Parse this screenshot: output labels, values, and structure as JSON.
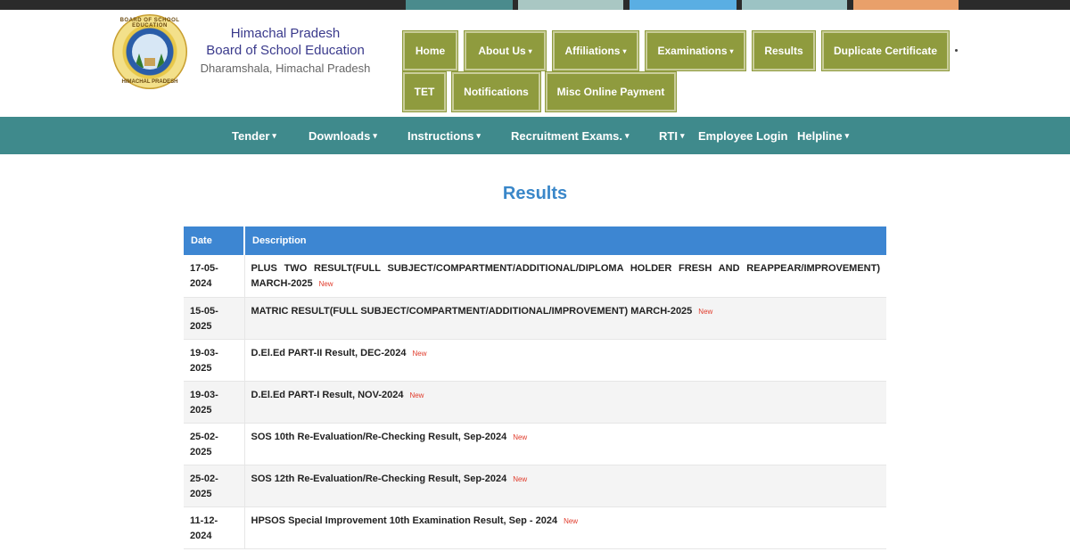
{
  "top_strip": {
    "tabs": [
      {
        "color": "#4a8b8d"
      },
      {
        "color": "#a9c7c3"
      },
      {
        "color": "#5aaee3"
      },
      {
        "color": "#9cc3c4"
      },
      {
        "color": "#e9a06a"
      }
    ]
  },
  "header": {
    "logo": {
      "top_text": "BOARD OF SCHOOL EDUCATION",
      "bottom_text": "HIMACHAL PRADESH"
    },
    "org_line1": "Himachal Pradesh",
    "org_line2": "Board of School Education",
    "org_line3": "Dharamshala, Himachal Pradesh"
  },
  "main_nav": {
    "items": [
      {
        "label": "Home",
        "dropdown": false
      },
      {
        "label": "About Us",
        "dropdown": true
      },
      {
        "label": "Affiliations",
        "dropdown": true
      },
      {
        "label": "Examinations",
        "dropdown": true
      },
      {
        "label": "Results",
        "dropdown": false
      },
      {
        "label": "Duplicate Certificate",
        "dropdown": false
      },
      {
        "label": "TET",
        "dropdown": false
      },
      {
        "label": "Notifications",
        "dropdown": false
      },
      {
        "label": "Misc Online Payment",
        "dropdown": false
      }
    ],
    "caret": "▾"
  },
  "secondary_nav": {
    "items": [
      {
        "label": "Tender",
        "dropdown": true
      },
      {
        "label": "Downloads",
        "dropdown": true
      },
      {
        "label": "Instructions",
        "dropdown": true
      },
      {
        "label": "Recruitment Exams.",
        "dropdown": true
      },
      {
        "label": "RTI",
        "dropdown": true
      },
      {
        "label": "Employee Login",
        "dropdown": false
      },
      {
        "label": "Helpline",
        "dropdown": true
      }
    ]
  },
  "page": {
    "title": "Results"
  },
  "table": {
    "columns": [
      "Date",
      "Description"
    ],
    "new_label": "New",
    "rows": [
      {
        "date": "17-05-2024",
        "description": "PLUS TWO RESULT(FULL SUBJECT/COMPARTMENT/ADDITIONAL/DIPLOMA HOLDER FRESH AND REAPPEAR/IMPROVEMENT) MARCH-2025",
        "is_new": true
      },
      {
        "date": "15-05-2025",
        "description": "MATRIC RESULT(FULL SUBJECT/COMPARTMENT/ADDITIONAL/IMPROVEMENT) MARCH-2025",
        "is_new": true
      },
      {
        "date": "19-03-2025",
        "description": "D.El.Ed PART-II Result, DEC-2024",
        "is_new": true
      },
      {
        "date": "19-03-2025",
        "description": "D.El.Ed PART-I Result, NOV-2024",
        "is_new": true
      },
      {
        "date": "25-02-2025",
        "description": "SOS 10th Re-Evaluation/Re-Checking Result, Sep-2024",
        "is_new": true
      },
      {
        "date": "25-02-2025",
        "description": "SOS 12th Re-Evaluation/Re-Checking Result, Sep-2024",
        "is_new": true
      },
      {
        "date": "11-12-2024",
        "description": "HPSOS Special Improvement 10th Examination Result, Sep - 2024",
        "is_new": true
      }
    ]
  }
}
